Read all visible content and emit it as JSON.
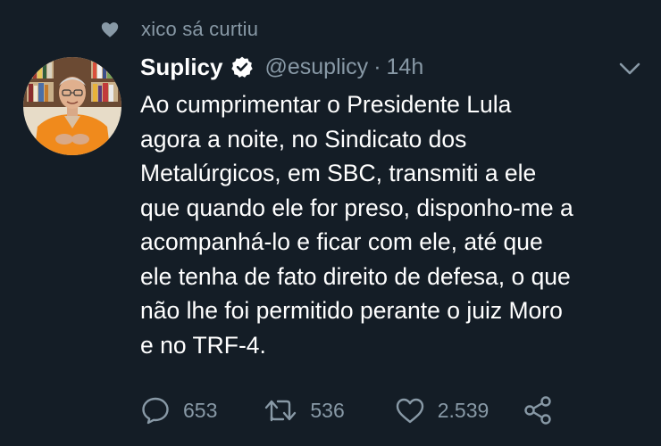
{
  "social_context": {
    "icon": "heart-icon",
    "text": "xico sá curtiu"
  },
  "author": {
    "avatar_icon": "avatar",
    "display_name": "Suplicy",
    "verified_icon": "verified-badge-icon",
    "handle": "@esuplicy",
    "separator": "·",
    "time": "14h"
  },
  "tweet": {
    "lines": [
      "Ao cumprimentar o Presidente Lula",
      "agora a noite, no Sindicato dos",
      "Metalúrgicos, em SBC, transmiti a ele",
      "que quando ele for preso, disponho-me a",
      "acompanhá-lo e ficar com ele, até que",
      "ele tenha de fato direito de defesa, o que",
      "não lhe foi permitido perante o juiz Moro",
      "e no TRF-4."
    ]
  },
  "actions": {
    "reply_count": "653",
    "retweet_count": "536",
    "like_count": "2.539",
    "icons": [
      "reply-icon",
      "retweet-icon",
      "like-icon",
      "share-icon"
    ]
  },
  "colors": {
    "background": "#141d26",
    "text": "#ffffff",
    "secondary": "#8899a6",
    "avatar_shirt": "#f08a1c"
  }
}
